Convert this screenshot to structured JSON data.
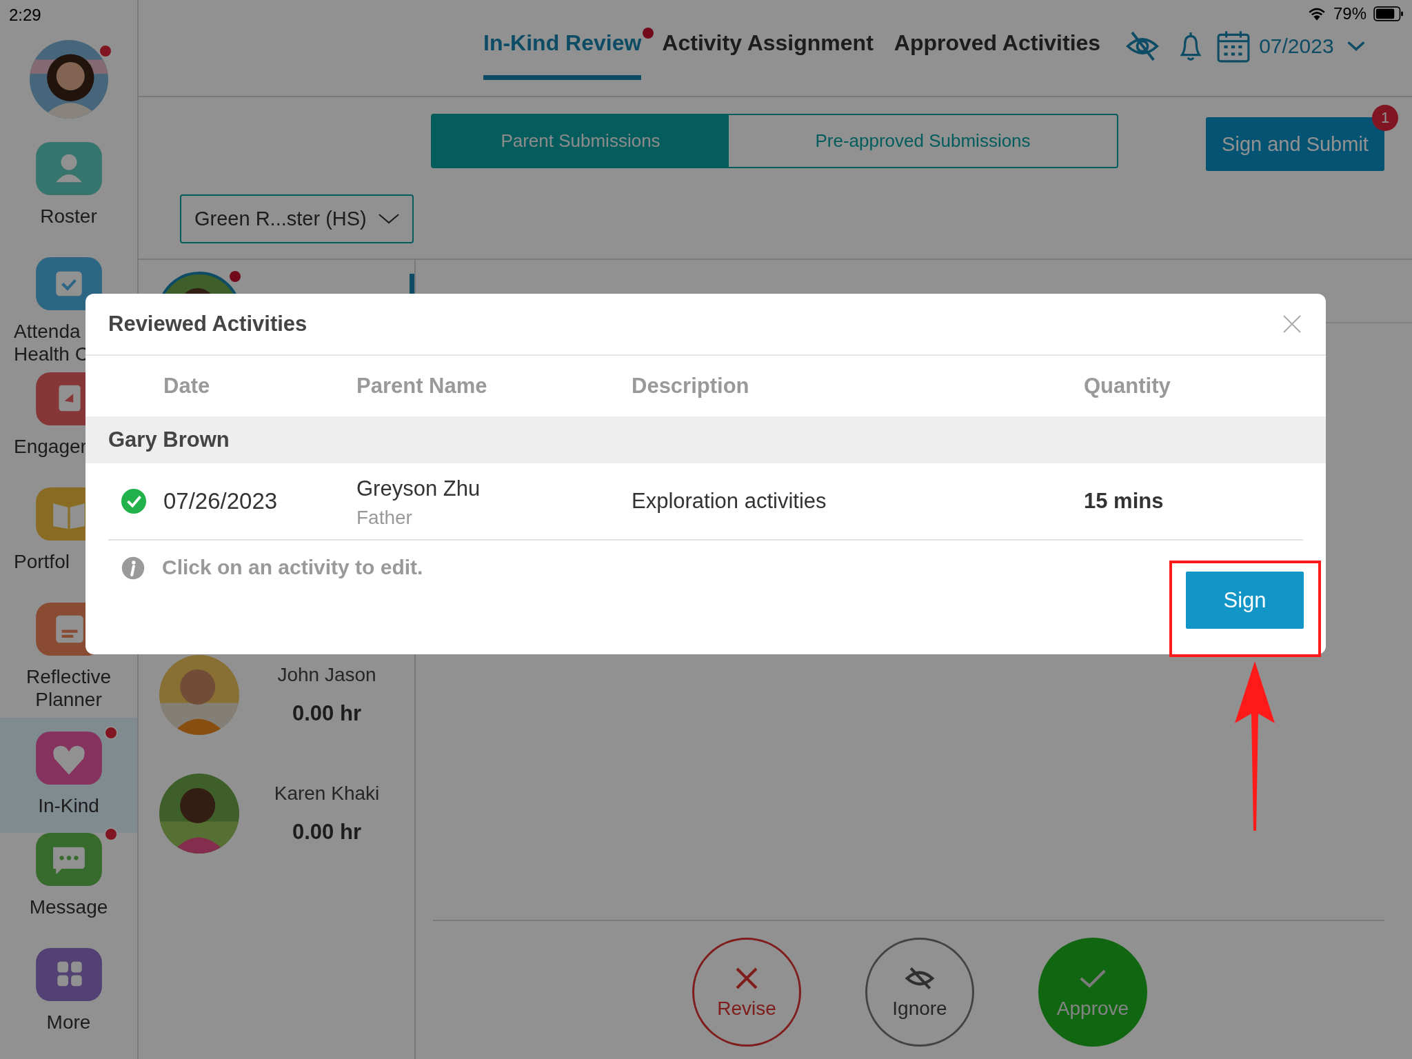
{
  "status_bar": {
    "time": "2:29",
    "battery": "79%"
  },
  "profile": {
    "notification": true
  },
  "sidebar": {
    "items": [
      {
        "kind": "roster",
        "lines": [
          "Roster"
        ],
        "selected": false,
        "notification": false,
        "covered": false
      },
      {
        "kind": "attendance",
        "lines": [
          "Attenda",
          "Health C"
        ],
        "selected": false,
        "notification": false,
        "covered": true
      },
      {
        "kind": "engagement",
        "lines": [
          "Engager"
        ],
        "selected": false,
        "notification": false,
        "covered": true
      },
      {
        "kind": "portfolio",
        "lines": [
          "Portfol"
        ],
        "selected": false,
        "notification": false,
        "covered": true
      },
      {
        "kind": "planner",
        "lines": [
          "Reflective",
          "Planner"
        ],
        "selected": false,
        "notification": false,
        "covered": false
      },
      {
        "kind": "inkind",
        "lines": [
          "In-Kind"
        ],
        "selected": true,
        "notification": true,
        "covered": false
      },
      {
        "kind": "message",
        "lines": [
          "Message"
        ],
        "selected": false,
        "notification": true,
        "covered": false
      },
      {
        "kind": "more",
        "lines": [
          "More"
        ],
        "selected": false,
        "notification": false,
        "covered": false
      }
    ]
  },
  "tabs": [
    {
      "label": "In-Kind Review",
      "selected": true,
      "notification": true
    },
    {
      "label": "Activity Assignment",
      "selected": false,
      "notification": false
    },
    {
      "label": "Approved Activities",
      "selected": false,
      "notification": false
    }
  ],
  "month": "07/2023",
  "segments": [
    {
      "label": "Parent Submissions",
      "selected": true
    },
    {
      "label": "Pre-approved Submissions",
      "selected": false
    }
  ],
  "sign_and_submit": {
    "label": "Sign and Submit",
    "badge": "1"
  },
  "roster_select": {
    "value": "Green R...ster (HS)"
  },
  "students": [
    {
      "selected": true,
      "notification": true
    },
    {
      "name": "John Jason",
      "hours": "0.00 hr",
      "selected": false,
      "notification": false
    },
    {
      "name": "Karen Khaki",
      "hours": "0.00 hr",
      "selected": false,
      "notification": false
    }
  ],
  "actions": [
    {
      "kind": "revise",
      "label": "Revise"
    },
    {
      "kind": "ignore",
      "label": "Ignore"
    },
    {
      "kind": "approve",
      "label": "Approve"
    }
  ],
  "modal": {
    "title": "Reviewed Activities",
    "columns": [
      "Date",
      "Parent Name",
      "Description",
      "Quantity"
    ],
    "groups": [
      {
        "name": "Gary Brown",
        "rows": [
          {
            "approved": true,
            "date": "07/26/2023",
            "parent": "Greyson Zhu",
            "relation": "Father",
            "description": "Exploration activities",
            "quantity": "15 mins"
          }
        ]
      }
    ],
    "hint": "Click on an activity to edit.",
    "button": "Sign"
  },
  "annotations": {
    "highlight_box": true,
    "arrow": true
  }
}
